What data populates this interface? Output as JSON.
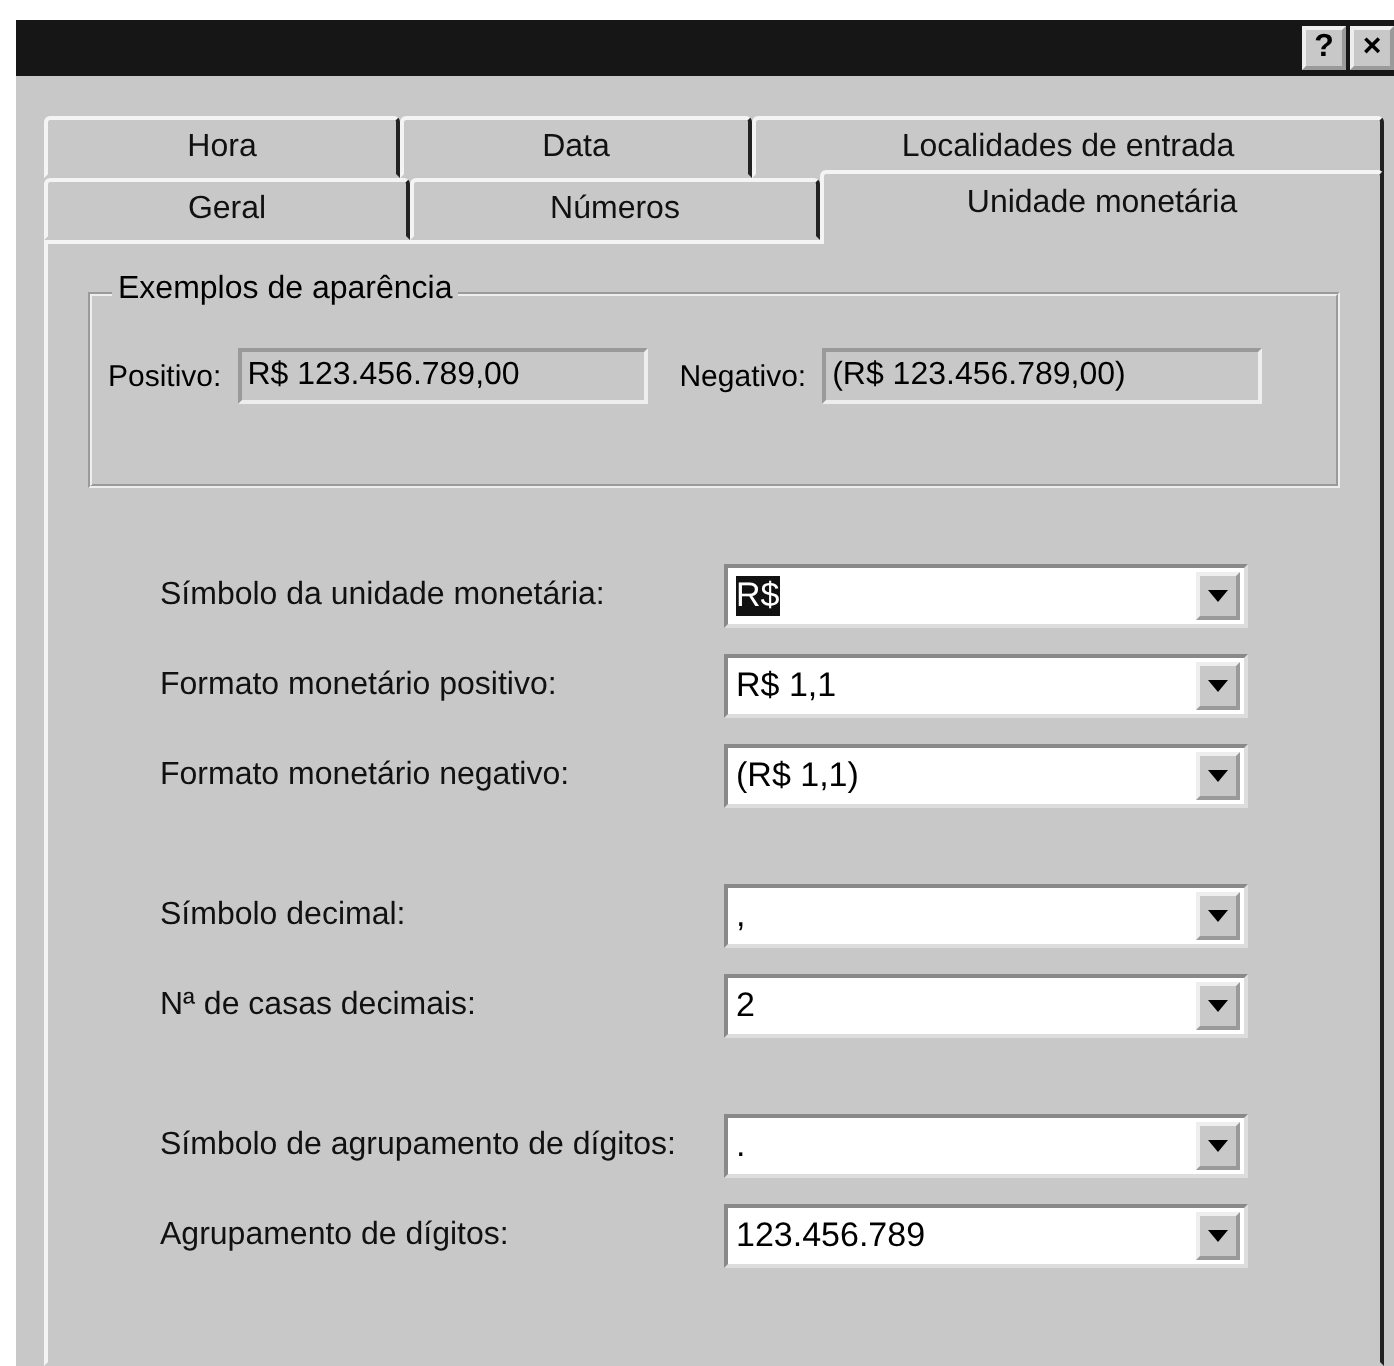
{
  "title_bar": {
    "buttons": [
      "?",
      "×"
    ]
  },
  "tab_rows": [
    {
      "tabs": [
        {
          "label": "Hora",
          "selected": false
        },
        {
          "label": "Data",
          "selected": false
        },
        {
          "label": "Localidades de entrada",
          "selected": false
        }
      ]
    },
    {
      "tabs": [
        {
          "label": "Geral",
          "selected": false
        },
        {
          "label": "Números",
          "selected": false
        },
        {
          "label": "Unidade monetária",
          "selected": true
        }
      ]
    }
  ],
  "examples": {
    "title": "Exemplos de aparência",
    "positive_label": "Positivo:",
    "positive_value": "R$ 123.456.789,00",
    "negative_label": "Negativo:",
    "negative_value": "(R$ 123.456.789,00)"
  },
  "field_groups": [
    {
      "fields": [
        {
          "label": "Símbolo da unidade monetária:",
          "value": "R$",
          "text_selected": true
        },
        {
          "label": "Formato monetário positivo:",
          "value": "R$ 1,1",
          "text_selected": false
        },
        {
          "label": "Formato monetário negativo:",
          "value": "(R$ 1,1)",
          "text_selected": false
        }
      ]
    },
    {
      "fields": [
        {
          "label": "Símbolo decimal:",
          "value": ",",
          "text_selected": false
        },
        {
          "label": "Nª de casas decimais:",
          "value": "2",
          "text_selected": false
        }
      ]
    },
    {
      "fields": [
        {
          "label": "Símbolo de agrupamento de dígitos:",
          "value": ".",
          "text_selected": false
        },
        {
          "label": "Agrupamento de dígitos:",
          "value": "123.456.789",
          "text_selected": false
        }
      ]
    }
  ]
}
